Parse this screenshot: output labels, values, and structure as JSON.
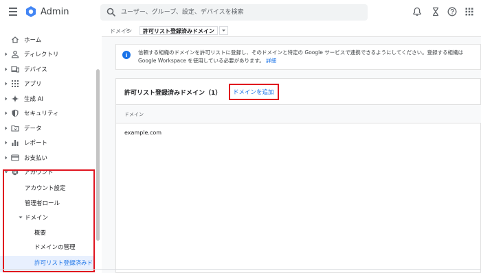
{
  "app": {
    "title": "Admin"
  },
  "search": {
    "placeholder": "ユーザー、グループ、設定、デバイスを検索"
  },
  "header_icons": [
    "bell-icon",
    "hourglass-icon",
    "help-icon",
    "apps-grid-icon"
  ],
  "sidebar": {
    "items": [
      {
        "label": "ホーム",
        "icon": "home-icon"
      },
      {
        "label": "ディレクトリ",
        "icon": "person-icon"
      },
      {
        "label": "デバイス",
        "icon": "devices-icon"
      },
      {
        "label": "アプリ",
        "icon": "apps-icon"
      },
      {
        "label": "生成 AI",
        "icon": "sparkle-icon"
      },
      {
        "label": "セキュリティ",
        "icon": "shield-icon"
      },
      {
        "label": "データ",
        "icon": "folder-icon"
      },
      {
        "label": "レポート",
        "icon": "bar-chart-icon"
      },
      {
        "label": "お支払い",
        "icon": "credit-card-icon"
      },
      {
        "label": "アカウント",
        "icon": "at-icon"
      }
    ],
    "account_sub": {
      "account_settings": "アカウント設定",
      "admin_roles": "管理者ロール",
      "domains": "ドメイン",
      "overview": "概要",
      "manage_domains": "ドメインの管理",
      "allowlisted_domains": "許可リスト登録済みドメイン"
    }
  },
  "breadcrumb": {
    "root": "ドメイン",
    "separator": ">",
    "current": "許可リスト登録済みドメイン"
  },
  "info": {
    "text": "信頼する組織のドメインを許可リストに登録し、そのドメインと特定の Google サービスで連携できるようにしてください。登録する組織は Google Workspace を使用している必要があります。",
    "link": "詳細"
  },
  "list": {
    "title": "許可リスト登録済みドメイン（1）",
    "add_button": "ドメインを追加",
    "column_header": "ドメイン",
    "rows": [
      "example.com"
    ]
  },
  "colors": {
    "accent": "#1a73e8",
    "highlight_red": "#e0131e",
    "selected_bg": "#e8f0fe"
  }
}
